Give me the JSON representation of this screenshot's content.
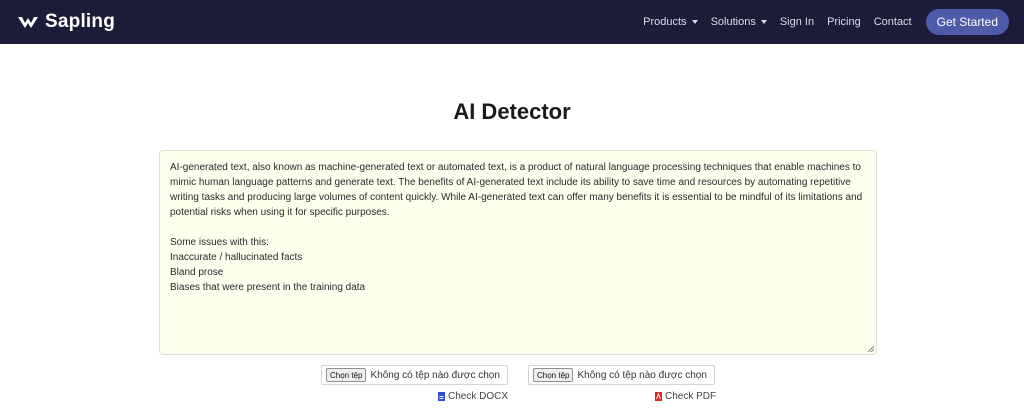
{
  "nav": {
    "brand": "Sapling",
    "links": [
      {
        "label": "Products",
        "dropdown": true
      },
      {
        "label": "Solutions",
        "dropdown": true
      },
      {
        "label": "Sign In",
        "dropdown": false
      },
      {
        "label": "Pricing",
        "dropdown": false
      },
      {
        "label": "Contact",
        "dropdown": false
      }
    ],
    "cta": "Get Started"
  },
  "main": {
    "title": "AI Detector",
    "text": "AI-generated text, also known as machine-generated text or automated text, is a product of natural language processing techniques that enable machines to mimic human language patterns and generate text. The benefits of AI-generated text include its ability to save time and resources by automating repetitive writing tasks and producing large volumes of content quickly. While AI-generated text can offer many benefits it is essential to be mindful of its limitations and potential risks when using it for specific purposes.\n\nSome issues with this:\nInaccurate / hallucinated facts\nBland prose\nBiases that were present in the training data"
  },
  "uploads": {
    "docx": {
      "button": "Chọn tệp",
      "status": "Không có tệp nào được chọn",
      "action": "Check DOCX"
    },
    "pdf": {
      "button": "Chọn tệp",
      "status": "Không có tệp nào được chọn",
      "action": "Check PDF"
    }
  },
  "colors": {
    "navbar": "#1c1b38",
    "cta": "#4f5aa8",
    "textarea_bg": "#fefeec",
    "docx_icon": "#2b4fd6",
    "pdf_icon": "#e02424"
  }
}
